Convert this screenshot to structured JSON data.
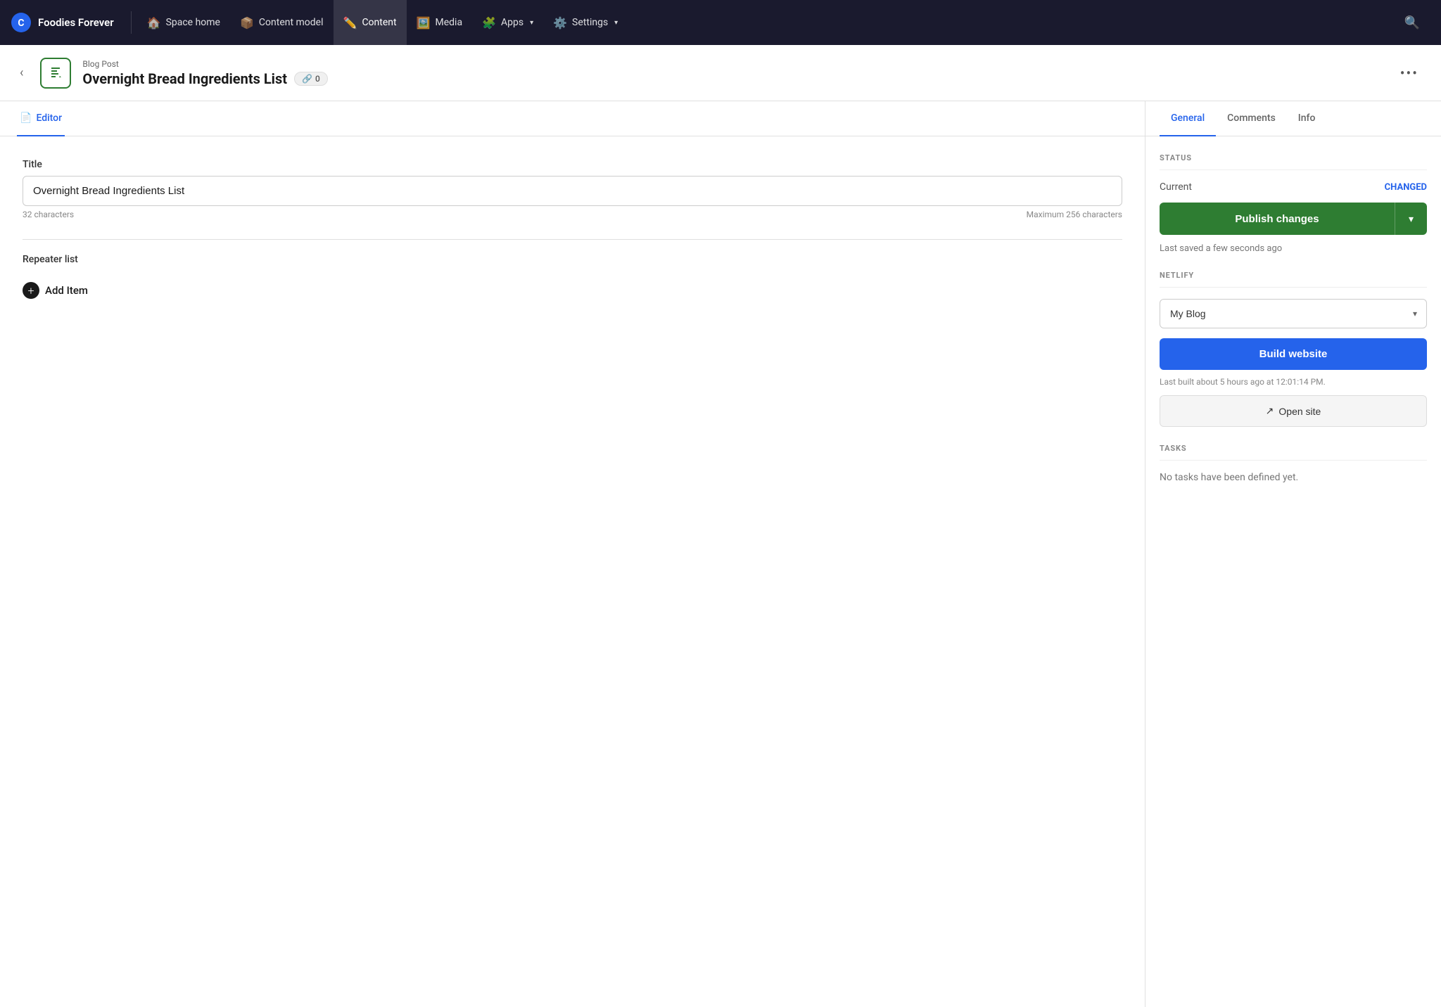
{
  "nav": {
    "brand": "Foodies Forever",
    "items": [
      {
        "id": "space-home",
        "label": "Space home",
        "icon": "🏠"
      },
      {
        "id": "content-model",
        "label": "Content model",
        "icon": "📦"
      },
      {
        "id": "content",
        "label": "Content",
        "icon": "✏️",
        "active": true
      },
      {
        "id": "media",
        "label": "Media",
        "icon": "🖼️"
      },
      {
        "id": "apps",
        "label": "Apps",
        "icon": "🧩",
        "hasArrow": true
      },
      {
        "id": "settings",
        "label": "Settings",
        "icon": "⚙️",
        "hasArrow": true
      }
    ]
  },
  "header": {
    "content_type": "Blog Post",
    "entry_title": "Overnight Bread Ingredients List",
    "link_count": "0"
  },
  "editor": {
    "tab_label": "Editor",
    "field_title_label": "Title",
    "field_title_value": "Overnight Bread Ingredients List",
    "char_count": "32 characters",
    "max_chars": "Maximum 256 characters",
    "repeater_label": "Repeater list",
    "add_item_label": "Add Item"
  },
  "sidebar": {
    "tabs": [
      {
        "id": "general",
        "label": "General",
        "active": true
      },
      {
        "id": "comments",
        "label": "Comments"
      },
      {
        "id": "info",
        "label": "Info"
      }
    ],
    "status": {
      "section_label": "STATUS",
      "current_label": "Current",
      "changed_label": "CHANGED",
      "publish_label": "Publish changes",
      "last_saved": "Last saved a few seconds ago"
    },
    "netlify": {
      "section_label": "NETLIFY",
      "dropdown_value": "My Blog",
      "dropdown_options": [
        "My Blog"
      ],
      "build_label": "Build website",
      "last_built": "Last built about 5 hours ago at 12:01:14 PM.",
      "open_site_label": "Open site"
    },
    "tasks": {
      "section_label": "TASKS",
      "no_tasks_label": "No tasks have been defined yet."
    }
  }
}
